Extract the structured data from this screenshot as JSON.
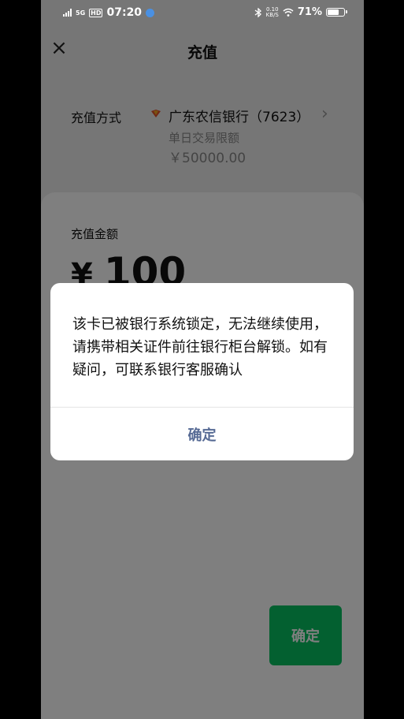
{
  "status_bar": {
    "network_type": "5G",
    "hd_label": "HD",
    "time": "07:20",
    "net_speed_value": "0.10",
    "net_speed_unit": "KB/S",
    "battery_percent": "71%",
    "battery_level": 0.71
  },
  "nav": {
    "close_glyph": "×",
    "title": "充值"
  },
  "recharge_method": {
    "label": "充值方式",
    "bank_name": "广东农信银行（7623）",
    "chevron_glyph": "›",
    "limit_label": "单日交易限额",
    "limit_value": "￥50000.00"
  },
  "amount": {
    "label": "充值金额",
    "currency": "¥",
    "value": "100"
  },
  "confirm_button": {
    "label": "确定",
    "color": "#07c160"
  },
  "dialog": {
    "message": "该卡已被银行系统锁定，无法继续使用，请携带相关证件前往银行柜台解锁。如有疑问，可联系银行客服确认",
    "ok_label": "确定",
    "ok_color": "#576b95"
  },
  "icons": {
    "close": "close-icon",
    "bank": "bank-logo-icon",
    "chevron": "chevron-right-icon",
    "wifi": "wifi-icon",
    "battery": "battery-icon",
    "bluetooth": "bluetooth-icon"
  }
}
